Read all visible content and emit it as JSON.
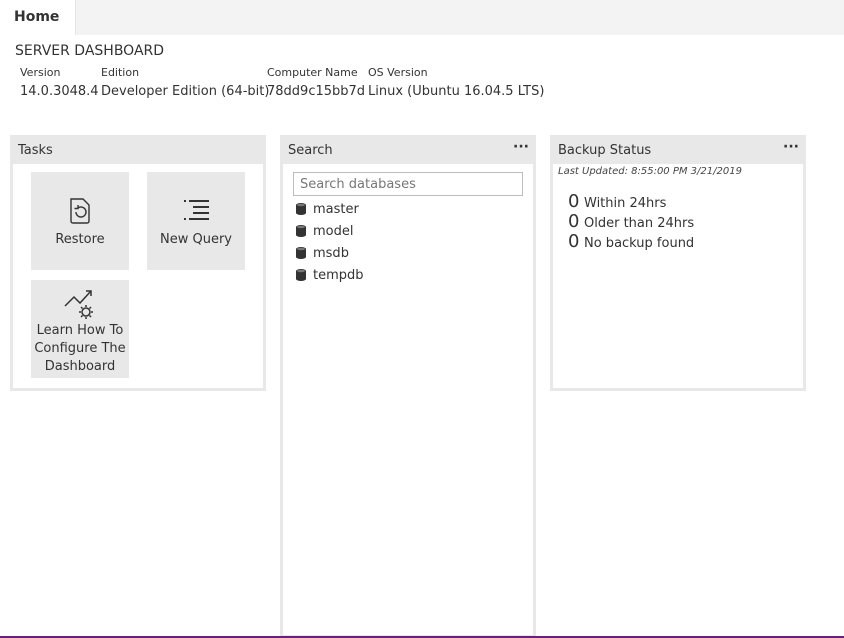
{
  "tab": {
    "label": "Home"
  },
  "dashboard": {
    "title": "SERVER DASHBOARD"
  },
  "properties": [
    {
      "label": "Version",
      "value": "14.0.3048.4"
    },
    {
      "label": "Edition",
      "value": "Developer Edition (64-bit)"
    },
    {
      "label": "Computer Name",
      "value": "78dd9c15bb7d"
    },
    {
      "label": "OS Version",
      "value": "Linux (Ubuntu 16.04.5 LTS)"
    }
  ],
  "tasks": {
    "title": "Tasks",
    "items": [
      {
        "label": "Restore",
        "icon": "restore-icon"
      },
      {
        "label": "New Query",
        "icon": "new-query-icon"
      },
      {
        "label": "Learn How To Configure The Dashboard",
        "icon": "configure-dashboard-icon"
      }
    ]
  },
  "search": {
    "title": "Search",
    "menu": "···",
    "placeholder": "Search databases",
    "databases": [
      "master",
      "model",
      "msdb",
      "tempdb"
    ],
    "icon": "database-icon"
  },
  "backup": {
    "title": "Backup Status",
    "menu": "···",
    "last_updated": "Last Updated: 8:55:00 PM 3/21/2019",
    "rows": [
      {
        "count": "0",
        "label": "Within 24hrs"
      },
      {
        "count": "0",
        "label": "Older than 24hrs"
      },
      {
        "count": "0",
        "label": "No backup found"
      }
    ]
  },
  "colors": {
    "accent": "#68217a",
    "widget_header": "#e8e8e8"
  }
}
